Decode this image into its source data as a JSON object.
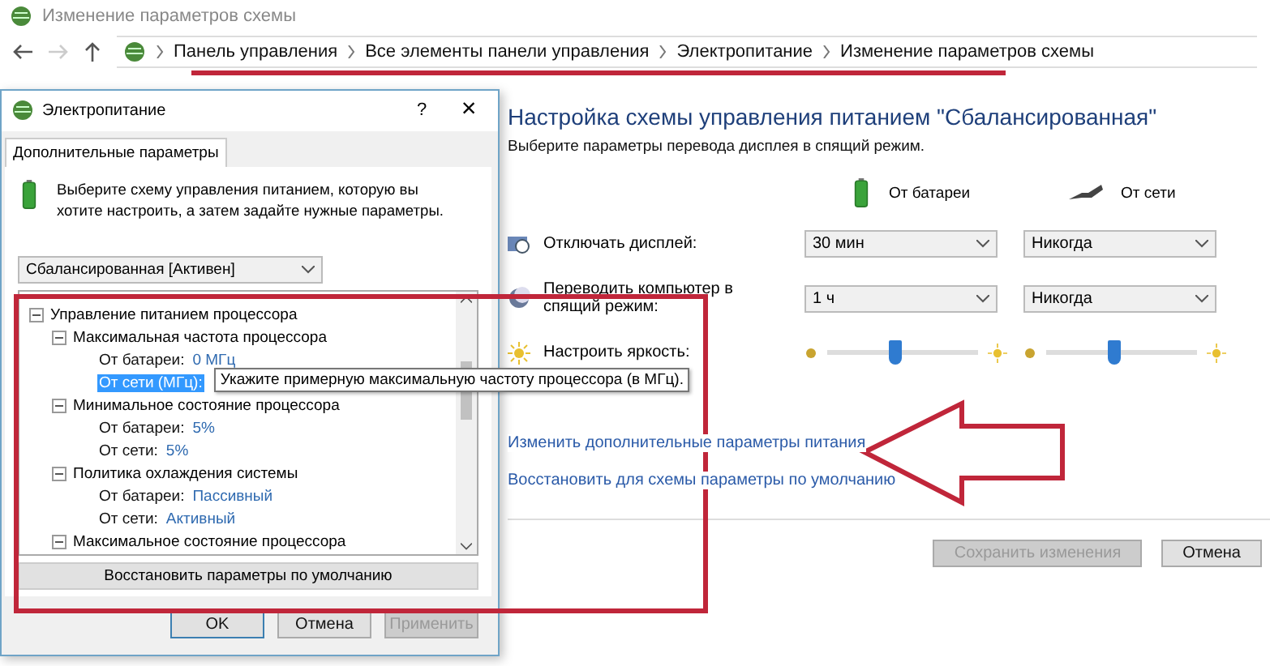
{
  "window": {
    "title": "Изменение параметров схемы"
  },
  "breadcrumb": [
    "Панель управления",
    "Все элементы панели управления",
    "Электропитание",
    "Изменение параметров схемы"
  ],
  "plan": {
    "heading": "Настройка схемы управления питанием \"Сбалансированная\"",
    "subtitle": "Выберите параметры перевода дисплея в спящий режим.",
    "columns": [
      "От батареи",
      "От сети"
    ],
    "rows": [
      {
        "kind": "select",
        "label": "Отключать дисплей:",
        "values": [
          "30 мин",
          "Никогда"
        ]
      },
      {
        "kind": "select",
        "label": "Переводить компьютер в спящий режим:",
        "values": [
          "1 ч",
          "Никогда"
        ]
      },
      {
        "kind": "slider",
        "label": "Настроить яркость:",
        "levels": [
          {
            "level": 0.45
          },
          {
            "level": 0.45
          }
        ]
      }
    ],
    "links": [
      "Изменить дополнительные параметры питания",
      "Восстановить для схемы параметры по умолчанию"
    ],
    "buttons": [
      {
        "label": "Сохранить изменения",
        "disabled": true
      },
      {
        "label": "Отмена",
        "disabled": false
      }
    ]
  },
  "dialog": {
    "title": "Электропитание",
    "help": "?",
    "close": "×",
    "tabs": [
      {
        "label": "Дополнительные параметры",
        "selected": true
      }
    ],
    "intro": "Выберите схему управления питанием, которую вы хотите настроить, а затем задайте нужные параметры.",
    "scheme": "Сбалансированная [Активен]",
    "tree": [
      {
        "label": "Управление питанием процессора",
        "expanded": true,
        "children": [
          {
            "label": "Максимальная частота процессора",
            "expanded": true,
            "children": [
              {
                "label": "От батареи:",
                "value": "0 МГц",
                "selected": false
              },
              {
                "label": "От сети (МГц):",
                "selected": true
              }
            ]
          },
          {
            "label": "Минимальное состояние процессора",
            "expanded": true,
            "children": [
              {
                "label": "От батареи:",
                "value": "5%",
                "selected": false
              },
              {
                "label": "От сети:",
                "value": "5%",
                "selected": false
              }
            ]
          },
          {
            "label": "Политика охлаждения системы",
            "expanded": true,
            "children": [
              {
                "label": "От батареи:",
                "value": "Пассивный",
                "selected": false
              },
              {
                "label": "От сети:",
                "value": "Активный",
                "selected": false
              }
            ]
          },
          {
            "label": "Максимальное состояние процессора",
            "expanded": true
          }
        ]
      }
    ],
    "tooltip": "Укажите примерную максимальную частоту процессора (в МГц).",
    "restore": "Восстановить параметры по умолчанию",
    "buttons": [
      {
        "label": "OK",
        "disabled": false,
        "default": true
      },
      {
        "label": "Отмена",
        "disabled": false,
        "default": false
      },
      {
        "label": "Применить",
        "disabled": true,
        "default": false
      }
    ]
  }
}
